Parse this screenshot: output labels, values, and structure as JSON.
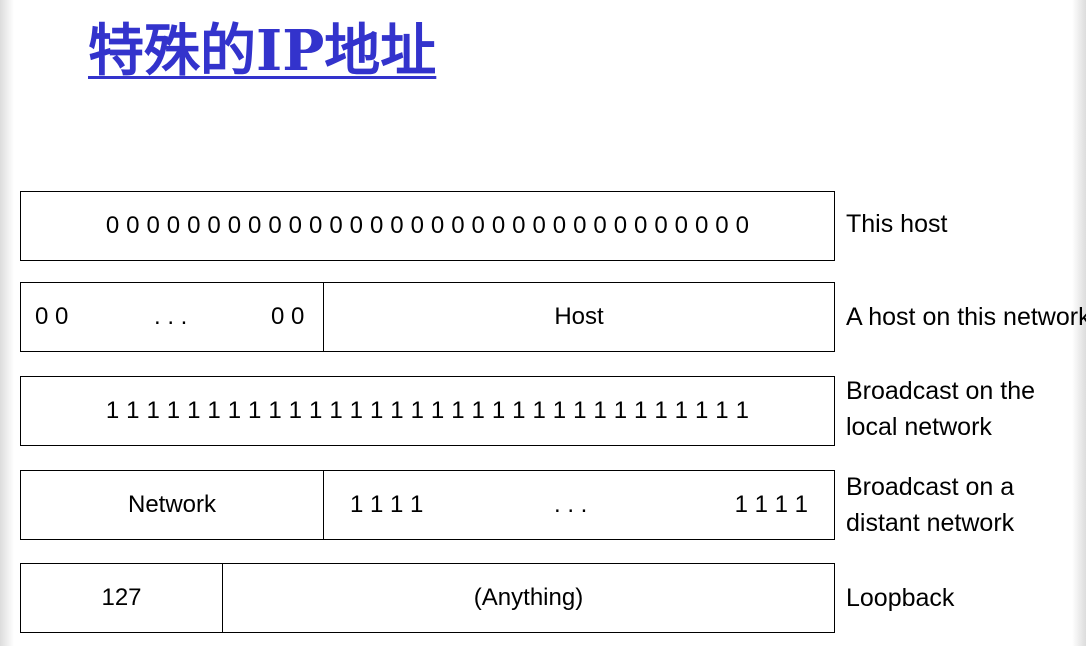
{
  "title": "特殊的IP地址",
  "rows": [
    {
      "cells": [
        "0 0 0 0 0 0 0 0 0 0 0 0 0 0 0 0 0 0 0 0 0 0 0 0 0 0 0 0 0 0 0 0"
      ],
      "description": [
        "This host"
      ]
    },
    {
      "cells": [
        "0 0",
        ". . .",
        "0 0",
        "Host"
      ],
      "description": [
        "A host on this network"
      ]
    },
    {
      "cells": [
        "1 1 1 1 1 1 1 1 1 1 1 1 1 1 1 1 1 1 1 1 1 1 1 1 1 1 1 1 1 1 1 1"
      ],
      "description": [
        "Broadcast on the",
        "local network"
      ]
    },
    {
      "cells": [
        "Network",
        "1 1 1 1",
        ". . .",
        "1 1 1 1"
      ],
      "description": [
        "Broadcast on a",
        "distant network"
      ]
    },
    {
      "cells": [
        "127",
        "(Anything)"
      ],
      "description": [
        "Loopback"
      ]
    }
  ]
}
